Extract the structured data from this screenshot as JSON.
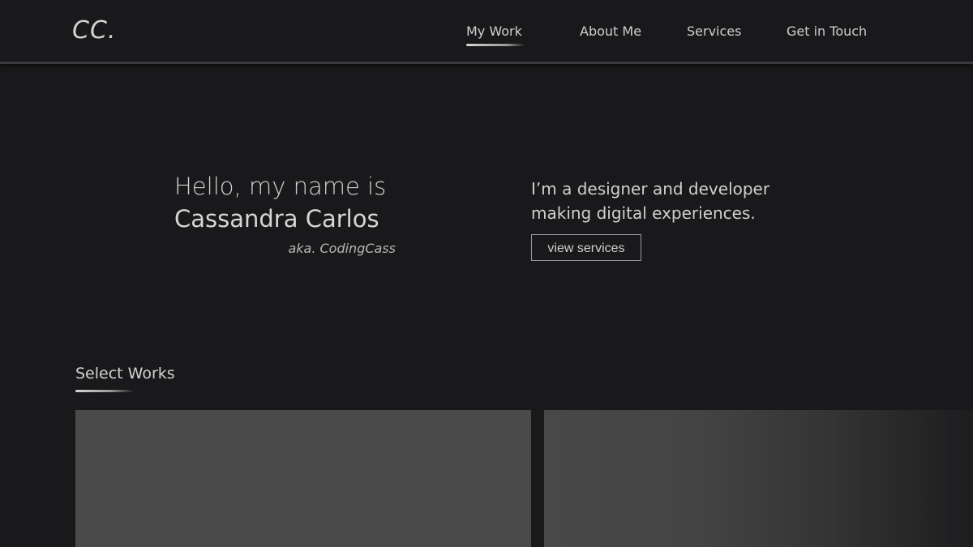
{
  "header": {
    "logo": "CC.",
    "nav": [
      {
        "label": "My Work",
        "active": true
      },
      {
        "label": "About Me",
        "active": false
      },
      {
        "label": "Services",
        "active": false
      },
      {
        "label": "Get in Touch",
        "active": false
      }
    ]
  },
  "hero": {
    "greeting": "Hello, my name is",
    "name": "Cassandra Carlos",
    "aka": "aka. CodingCass",
    "tagline_line1": "I’m a designer and developer",
    "tagline_line2": "making digital experiences.",
    "cta_label": "view services"
  },
  "works": {
    "title": "Select Works",
    "cards": [
      {
        "color": "#4a4a4a"
      },
      {
        "color": "#444444"
      }
    ]
  },
  "colors": {
    "background": "#19191b",
    "text": "#cfcfcf",
    "accent": "#d6d6d6"
  }
}
